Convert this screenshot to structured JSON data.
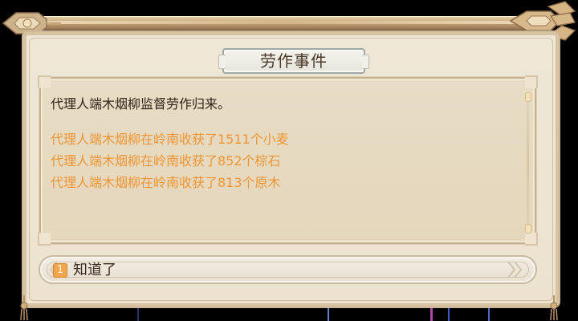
{
  "dialog": {
    "title": "劳作事件",
    "summary": "代理人端木烟柳监督劳作归来。",
    "results": [
      "代理人端木烟柳在岭南收获了1511个小麦",
      "代理人端木烟柳在岭南收获了852个棕石",
      "代理人端木烟柳在岭南收获了813个原木"
    ],
    "option": {
      "index": "1",
      "label": "知道了"
    }
  },
  "theme": {
    "frame_color": "#ece2cf",
    "panel_color": "#e7dcc5",
    "result_color": "#ef9533",
    "text_color": "#2f2418",
    "accent_color": "#f2a54b"
  },
  "icons": {
    "top_ornament_left": "scroll-end-left-ornament-icon",
    "top_ornament_right": "scroll-end-right-ornament-icon",
    "scroll": "scroll-indicator-icon",
    "option_cap_left": "option-cap-left-icon",
    "option_cap_right": "option-cap-right-icon",
    "tassel": "tassel-icon"
  }
}
